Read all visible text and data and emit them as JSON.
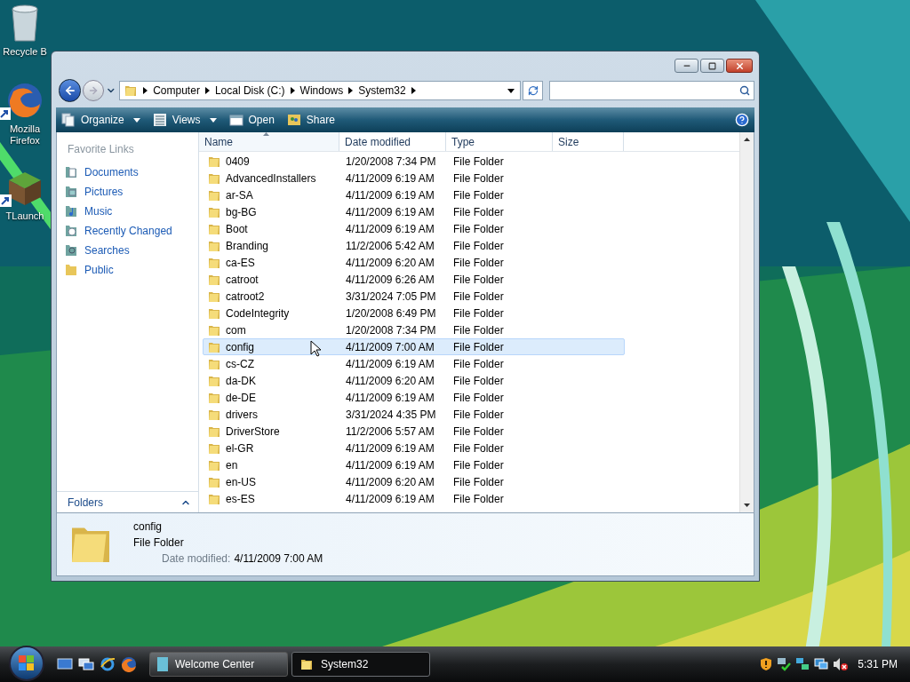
{
  "desktop_icons": [
    {
      "kind": "recycle-bin",
      "label": "Recycle B"
    },
    {
      "kind": "browser",
      "label": "Mozilla Firefox"
    },
    {
      "kind": "game",
      "label": "TLaunch"
    }
  ],
  "window": {
    "address": [
      "Computer",
      "Local Disk (C:)",
      "Windows",
      "System32"
    ],
    "toolbar": [
      {
        "kind": "organize",
        "label": "Organize",
        "dropdown": true
      },
      {
        "kind": "views",
        "label": "Views",
        "dropdown": true
      },
      {
        "kind": "open",
        "label": "Open",
        "dropdown": false
      },
      {
        "kind": "share",
        "label": "Share",
        "dropdown": false
      }
    ],
    "nav": {
      "heading": "Favorite Links",
      "items": [
        {
          "kind": "documents",
          "label": "Documents"
        },
        {
          "kind": "pictures",
          "label": "Pictures"
        },
        {
          "kind": "music",
          "label": "Music"
        },
        {
          "kind": "recent",
          "label": "Recently Changed"
        },
        {
          "kind": "searches",
          "label": "Searches"
        },
        {
          "kind": "public",
          "label": "Public"
        }
      ],
      "folders_label": "Folders",
      "folders_expanded": false
    },
    "columns": [
      "Name",
      "Date modified",
      "Type",
      "Size"
    ],
    "rows": [
      {
        "name": "0409",
        "date": "1/20/2008 7:34 PM",
        "type": "File Folder",
        "selected": false
      },
      {
        "name": "AdvancedInstallers",
        "date": "4/11/2009 6:19 AM",
        "type": "File Folder",
        "selected": false
      },
      {
        "name": "ar-SA",
        "date": "4/11/2009 6:19 AM",
        "type": "File Folder",
        "selected": false
      },
      {
        "name": "bg-BG",
        "date": "4/11/2009 6:19 AM",
        "type": "File Folder",
        "selected": false
      },
      {
        "name": "Boot",
        "date": "4/11/2009 6:19 AM",
        "type": "File Folder",
        "selected": false
      },
      {
        "name": "Branding",
        "date": "11/2/2006 5:42 AM",
        "type": "File Folder",
        "selected": false
      },
      {
        "name": "ca-ES",
        "date": "4/11/2009 6:20 AM",
        "type": "File Folder",
        "selected": false
      },
      {
        "name": "catroot",
        "date": "4/11/2009 6:26 AM",
        "type": "File Folder",
        "selected": false
      },
      {
        "name": "catroot2",
        "date": "3/31/2024 7:05 PM",
        "type": "File Folder",
        "selected": false
      },
      {
        "name": "CodeIntegrity",
        "date": "1/20/2008 6:49 PM",
        "type": "File Folder",
        "selected": false
      },
      {
        "name": "com",
        "date": "1/20/2008 7:34 PM",
        "type": "File Folder",
        "selected": false
      },
      {
        "name": "config",
        "date": "4/11/2009 7:00 AM",
        "type": "File Folder",
        "selected": true
      },
      {
        "name": "cs-CZ",
        "date": "4/11/2009 6:19 AM",
        "type": "File Folder",
        "selected": false
      },
      {
        "name": "da-DK",
        "date": "4/11/2009 6:20 AM",
        "type": "File Folder",
        "selected": false
      },
      {
        "name": "de-DE",
        "date": "4/11/2009 6:19 AM",
        "type": "File Folder",
        "selected": false
      },
      {
        "name": "drivers",
        "date": "3/31/2024 4:35 PM",
        "type": "File Folder",
        "selected": false
      },
      {
        "name": "DriverStore",
        "date": "11/2/2006 5:57 AM",
        "type": "File Folder",
        "selected": false
      },
      {
        "name": "el-GR",
        "date": "4/11/2009 6:19 AM",
        "type": "File Folder",
        "selected": false
      },
      {
        "name": "en",
        "date": "4/11/2009 6:19 AM",
        "type": "File Folder",
        "selected": false
      },
      {
        "name": "en-US",
        "date": "4/11/2009 6:20 AM",
        "type": "File Folder",
        "selected": false
      },
      {
        "name": "es-ES",
        "date": "4/11/2009 6:19 AM",
        "type": "File Folder",
        "selected": false
      }
    ],
    "details": {
      "name": "config",
      "type": "File Folder",
      "date_label": "Date modified:",
      "date_value": "4/11/2009 7:00 AM"
    }
  },
  "taskbar": {
    "quick_launch": [
      {
        "kind": "desktop"
      },
      {
        "kind": "switch"
      },
      {
        "kind": "ie"
      },
      {
        "kind": "browser"
      }
    ],
    "tasks": [
      {
        "kind": "doc",
        "label": "Welcome Center",
        "selected": false
      },
      {
        "kind": "folder",
        "label": "System32",
        "selected": true
      }
    ],
    "tray": [
      {
        "kind": "shield"
      },
      {
        "kind": "network-check"
      },
      {
        "kind": "network"
      },
      {
        "kind": "monitor"
      },
      {
        "kind": "mute"
      }
    ],
    "clock": "5:31 PM"
  }
}
